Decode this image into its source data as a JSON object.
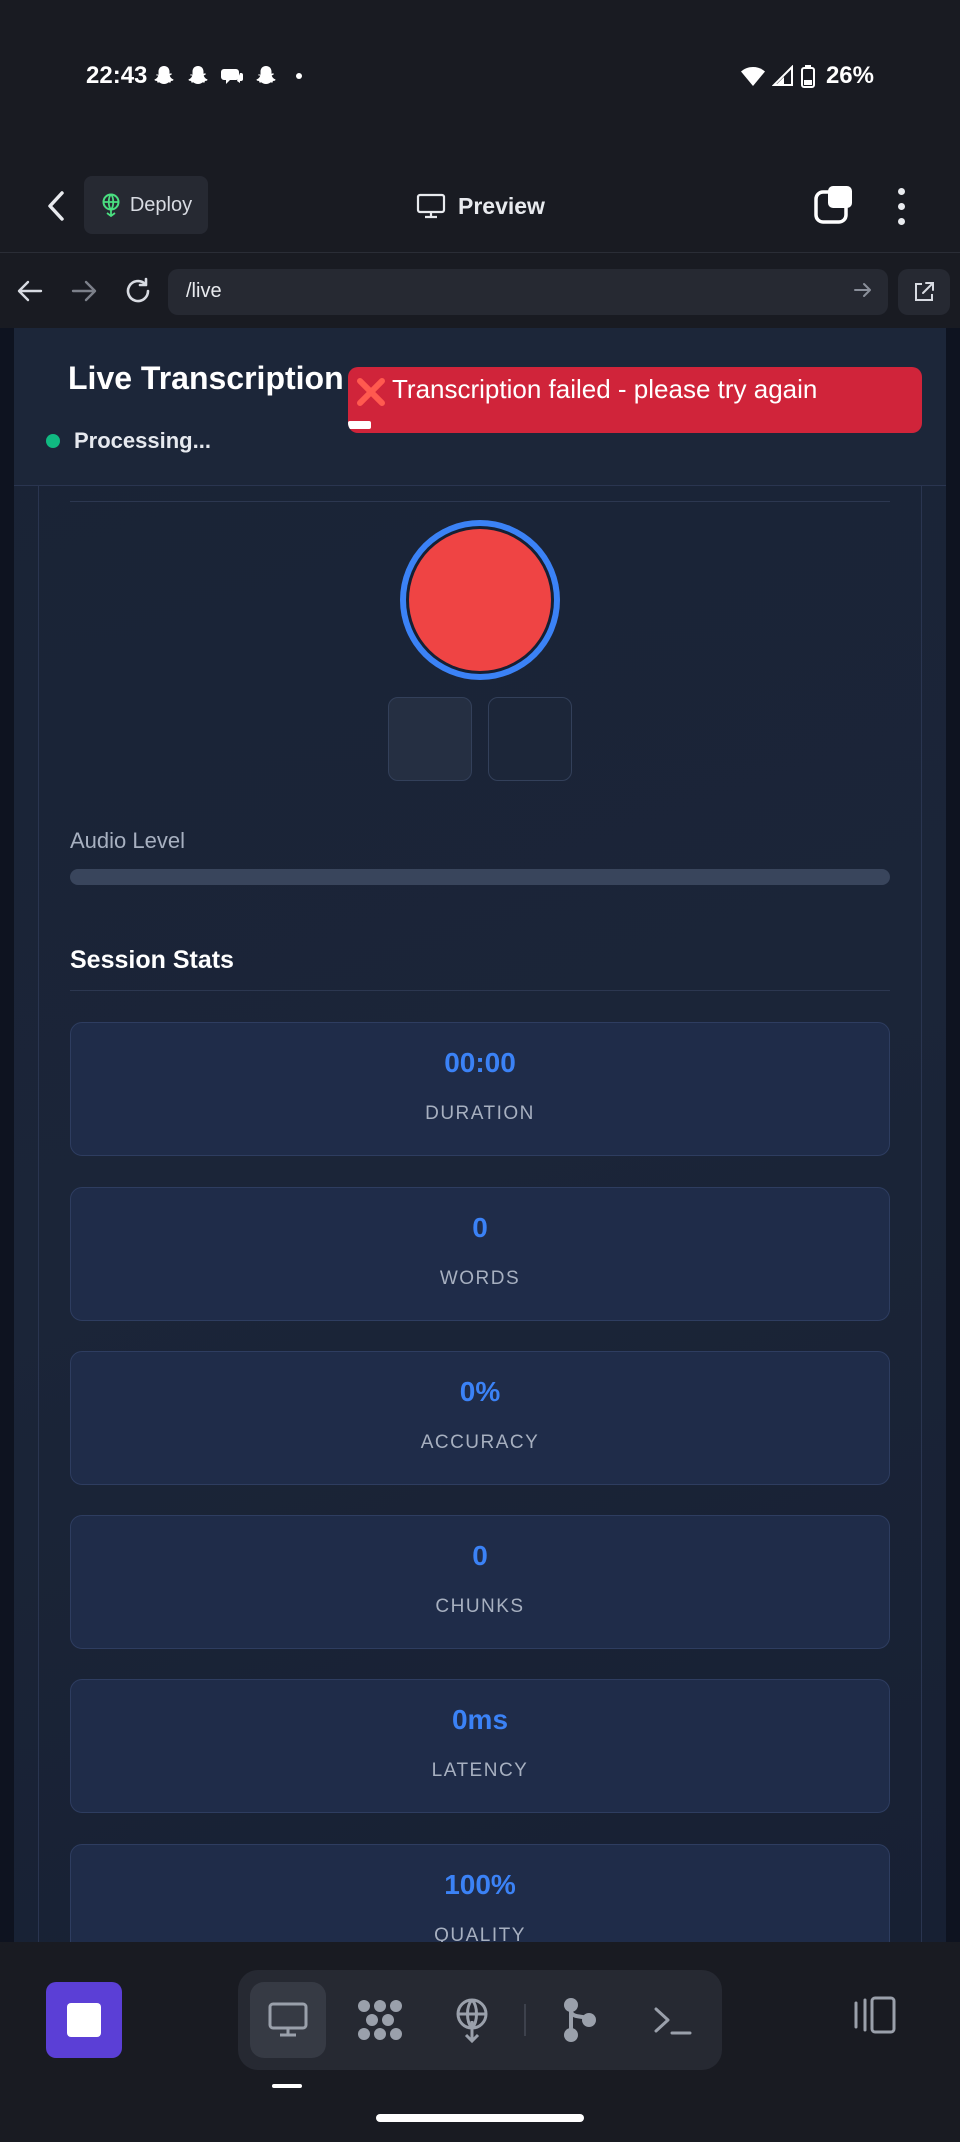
{
  "status_bar": {
    "time": "22:43",
    "battery_percent": "26%",
    "notification_icons": [
      "snapchat-icon",
      "snapchat-icon",
      "chat-icon",
      "snapchat-icon"
    ]
  },
  "app_bar": {
    "deploy_label": "Deploy",
    "preview_label": "Preview"
  },
  "browser": {
    "url": "/live"
  },
  "page": {
    "title": "Live Transcription",
    "status_text": "Processing...",
    "status_color": "#10b981",
    "toast": {
      "icon": "red-x-icon",
      "message": "Transcription failed - please try again",
      "progress_fraction": 0.04
    },
    "audio": {
      "label": "Audio Level",
      "level_fraction": 0.0
    },
    "stats": {
      "title": "Session Stats",
      "items": [
        {
          "value": "00:00",
          "label": "DURATION"
        },
        {
          "value": "0",
          "label": "WORDS"
        },
        {
          "value": "0%",
          "label": "ACCURACY"
        },
        {
          "value": "0",
          "label": "CHUNKS"
        },
        {
          "value": "0ms",
          "label": "LATENCY"
        },
        {
          "value": "100%",
          "label": "QUALITY"
        }
      ]
    }
  },
  "colors": {
    "accent": "#3b82f6",
    "record": "#ef4444",
    "error_toast": "#d0243a",
    "stop_button": "#5b3fd6"
  },
  "bottom_bar": {
    "tools": [
      "monitor-icon",
      "agents-icon",
      "deploy-icon",
      "git-icon",
      "terminal-icon"
    ],
    "active_tool": "monitor-icon"
  }
}
